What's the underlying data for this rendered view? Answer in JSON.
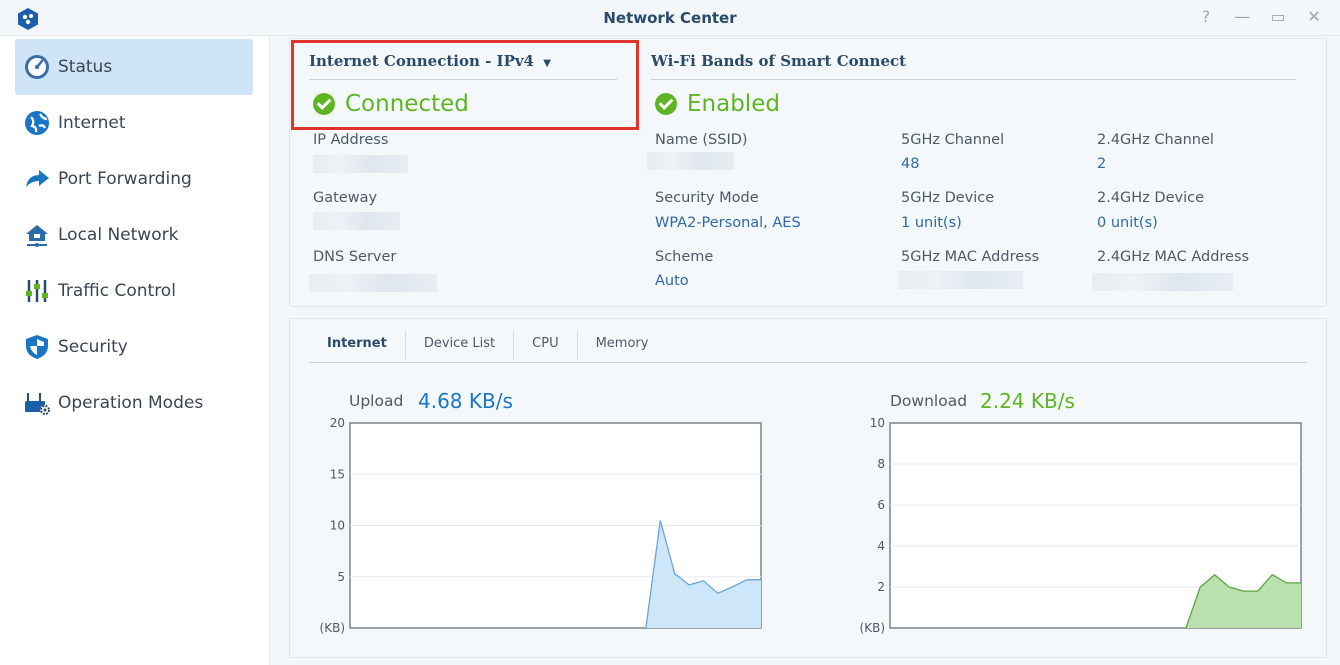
{
  "window": {
    "title": "Network Center",
    "controls": [
      "help-icon",
      "minimize-icon",
      "maximize-icon",
      "close-icon"
    ]
  },
  "sidebar": {
    "items": [
      {
        "label": "Status",
        "icon": "speedometer-icon",
        "active": true
      },
      {
        "label": "Internet",
        "icon": "globe-icon"
      },
      {
        "label": "Port Forwarding",
        "icon": "forward-arrow-icon"
      },
      {
        "label": "Local Network",
        "icon": "home-network-icon"
      },
      {
        "label": "Traffic Control",
        "icon": "sliders-icon"
      },
      {
        "label": "Security",
        "icon": "shield-icon"
      },
      {
        "label": "Operation Modes",
        "icon": "router-gear-icon"
      }
    ]
  },
  "internet": {
    "heading": "Internet Connection - ",
    "protocol": "IPv4",
    "status": "Connected",
    "ip_label": "IP Address",
    "gateway_label": "Gateway",
    "dns_label": "DNS Server"
  },
  "wifi": {
    "heading": "Wi-Fi Bands of Smart Connect",
    "status": "Enabled",
    "ssid_label": "Name (SSID)",
    "security_label": "Security Mode",
    "security_value": "WPA2-Personal, AES",
    "scheme_label": "Scheme",
    "scheme_value": "Auto",
    "ch5_label": "5GHz Channel",
    "ch5_value": "48",
    "dev5_label": "5GHz Device",
    "dev5_value": "1 unit(s)",
    "mac5_label": "5GHz MAC Address",
    "ch24_label": "2.4GHz Channel",
    "ch24_value": "2",
    "dev24_label": "2.4GHz Device",
    "dev24_value": "0 unit(s)",
    "mac24_label": "2.4GHz MAC Address"
  },
  "tabs": [
    "Internet",
    "Device List",
    "CPU",
    "Memory"
  ],
  "colors": {
    "upload": "#1a76c2",
    "download": "#5db524",
    "accent": "#2b4a6a"
  },
  "upload": {
    "label": "Upload",
    "value": "4.68 KB/s"
  },
  "download": {
    "label": "Download",
    "value": "2.24 KB/s"
  },
  "chart_data": [
    {
      "type": "area",
      "title": "Upload",
      "ylabel": "(KB)",
      "ylim": [
        0,
        20
      ],
      "yticks": [
        5,
        10,
        15,
        20
      ],
      "x": [
        0,
        1,
        2,
        3,
        4,
        5,
        6,
        7,
        8
      ],
      "values": [
        0,
        10.5,
        5.3,
        4.2,
        4.6,
        3.4,
        4.0,
        4.7,
        4.7
      ],
      "x_start_fraction": 0.72
    },
    {
      "type": "area",
      "title": "Download",
      "ylabel": "(KB)",
      "ylim": [
        0,
        10
      ],
      "yticks": [
        2,
        4,
        6,
        8,
        10
      ],
      "x": [
        0,
        1,
        2,
        3,
        4,
        5,
        6,
        7,
        8
      ],
      "values": [
        0,
        2.0,
        2.6,
        2.0,
        1.8,
        1.8,
        2.6,
        2.2,
        2.2
      ],
      "x_start_fraction": 0.72
    }
  ]
}
